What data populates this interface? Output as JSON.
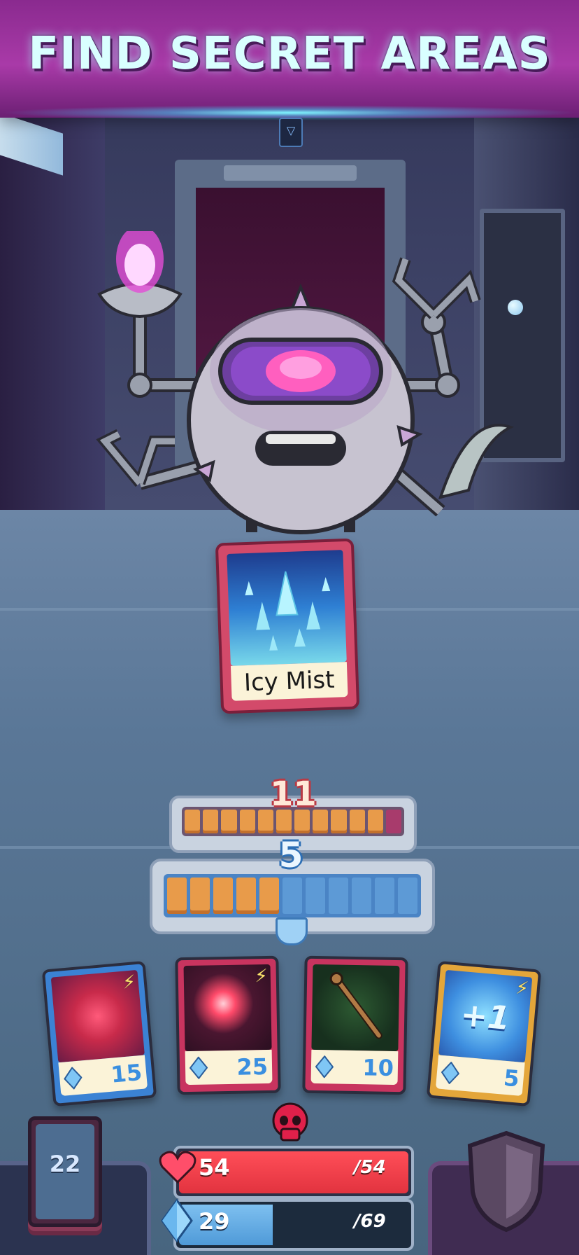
{
  "banner": {
    "title": "FIND SECRET AREAS"
  },
  "enemy": {
    "played_card": {
      "name": "Icy Mist"
    },
    "energy": {
      "value": "11",
      "segments_filled": 11,
      "segments_total": 12
    }
  },
  "player": {
    "energy": {
      "value": "5",
      "segments_filled": 5,
      "segments_total": 11
    },
    "hand": [
      {
        "id": "card-1",
        "cost": "15",
        "art": "red-burst",
        "has_bolt": true,
        "frame_color": "#3b82d4"
      },
      {
        "id": "card-2",
        "cost": "25",
        "art": "fire-orb",
        "has_bolt": true,
        "frame_color": "#c8345f"
      },
      {
        "id": "card-3",
        "cost": "10",
        "art": "staff",
        "has_bolt": false,
        "frame_color": "#c8345f"
      },
      {
        "id": "card-4",
        "cost": "5",
        "art": "plus-one",
        "art_text": "+1",
        "has_bolt": true,
        "frame_color": "#e4a63a"
      }
    ],
    "deck_count": "22",
    "health": {
      "current": "54",
      "max": "/54",
      "fill": 1.0,
      "color": "#ff4e58"
    },
    "mana": {
      "current": "29",
      "max": "/69",
      "fill": 0.42,
      "color": "#5fa8e4"
    }
  },
  "icons": {
    "ceiling": "sigil-icon",
    "skull": "skull-icon",
    "heart": "heart-icon",
    "gem": "gem-icon",
    "shield": "shield-icon",
    "bolt": "lightning-icon"
  }
}
